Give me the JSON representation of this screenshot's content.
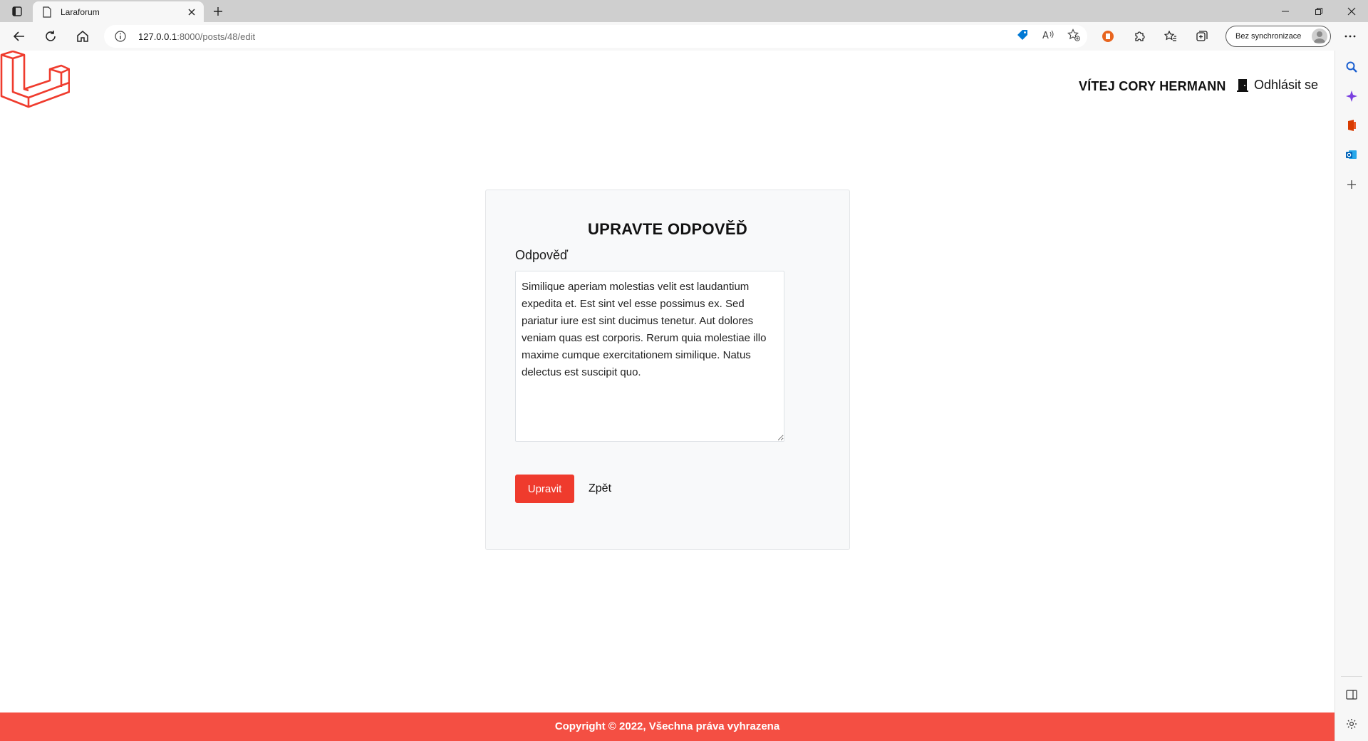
{
  "browser": {
    "tab_title": "Laraforum",
    "url_host": "127.0.0.1",
    "url_rest": ":8000/posts/48/edit",
    "profile_label": "Bez synchronizace",
    "accent": "#0078d4"
  },
  "nav": {
    "user_greeting": "VÍTEJ CORY HERMANN",
    "logout_label": "Odhlásit se"
  },
  "form": {
    "heading": "UPRAVTE ODPOVĚĎ",
    "answer_label": "Odpověď",
    "answer_value": "Similique aperiam molestias velit est laudantium expedita et. Est sint vel esse possimus ex. Sed pariatur iure est sint ducimus tenetur. Aut dolores veniam quas est corporis. Rerum quia molestiae illo maxime cumque exercitationem similique. Natus delectus est suscipit quo.",
    "submit_label": "Upravit",
    "back_label": "Zpět"
  },
  "footer": {
    "text": "Copyright © 2022, Všechna práva vyhrazena"
  },
  "colors": {
    "brand_red": "#ef3b2d",
    "footer_red": "#f44f43",
    "card_bg": "#f8f9fa"
  },
  "icons": {
    "brand_logo": "laravel-logo-icon",
    "logout": "door-icon"
  }
}
